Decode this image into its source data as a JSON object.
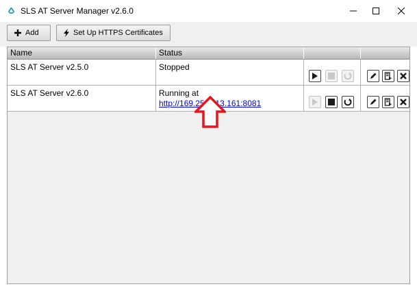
{
  "window": {
    "title": "SLS AT Server Manager v2.6.0",
    "icon": "app-droplet-icon",
    "controls": [
      "minimize-icon",
      "maximize-icon",
      "close-icon"
    ]
  },
  "toolbar": {
    "add_label": "Add",
    "https_label": "Set Up HTTPS Certificates"
  },
  "grid": {
    "columns": {
      "name": "Name",
      "status": "Status"
    },
    "rows": [
      {
        "name": "SLS AT Server v2.5.0",
        "status": "Stopped",
        "url": "",
        "start_enabled": true,
        "stop_enabled": false,
        "restart_enabled": false
      },
      {
        "name": "SLS AT Server v2.6.0",
        "status": "Running at",
        "url": "http://169.254.113.161:8081",
        "start_enabled": false,
        "stop_enabled": true,
        "restart_enabled": true
      }
    ]
  },
  "annotation": {
    "arrow_icon": "up-arrow-icon",
    "color": "#e8141b"
  },
  "colors": {
    "app_icon": "#1aa0b0",
    "link": "#0000ee"
  }
}
